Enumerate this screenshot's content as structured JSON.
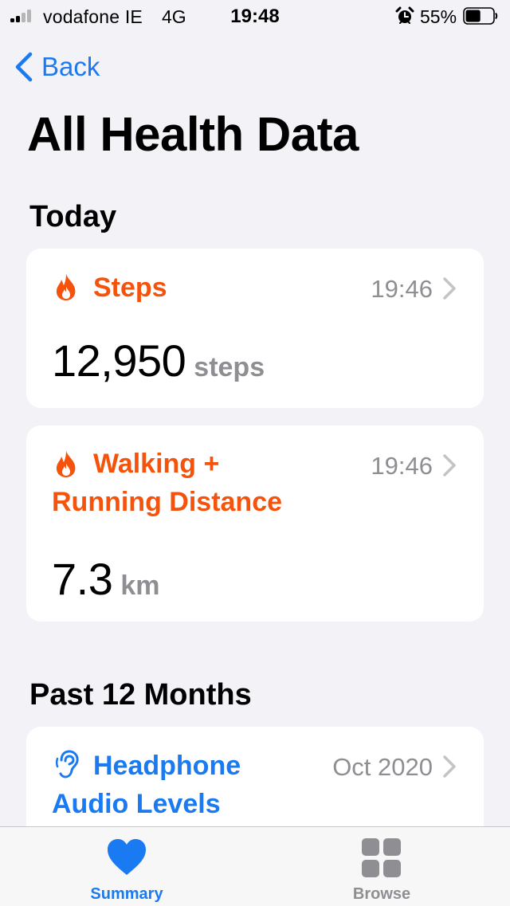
{
  "status_bar": {
    "carrier": "vodafone IE",
    "network": "4G",
    "time": "19:48",
    "battery_percent": "55%",
    "battery_level": 0.55
  },
  "nav": {
    "back_label": "Back"
  },
  "page_title": "All Health Data",
  "sections": [
    {
      "title": "Today",
      "cards": [
        {
          "title": "Steps",
          "time": "19:46",
          "value": "12,950",
          "unit": "steps",
          "color": "#f5520c",
          "icon": "flame-icon"
        },
        {
          "title_line1": "Walking +",
          "title_line2": "Running Distance",
          "time": "19:46",
          "value": "7.3",
          "unit": "km",
          "color": "#f5520c",
          "icon": "flame-icon"
        }
      ]
    },
    {
      "title": "Past 12 Months",
      "cards": [
        {
          "title_line1": "Headphone",
          "title_line2": "Audio Levels",
          "time": "Oct 2020",
          "color": "#1a7af1",
          "icon": "ear-icon"
        }
      ]
    }
  ],
  "tabbar": {
    "tabs": [
      {
        "label": "Summary",
        "icon": "heart-icon",
        "active": true,
        "color": "#1a7af1"
      },
      {
        "label": "Browse",
        "icon": "grid-icon",
        "active": false,
        "color": "#8e8e93"
      }
    ]
  }
}
